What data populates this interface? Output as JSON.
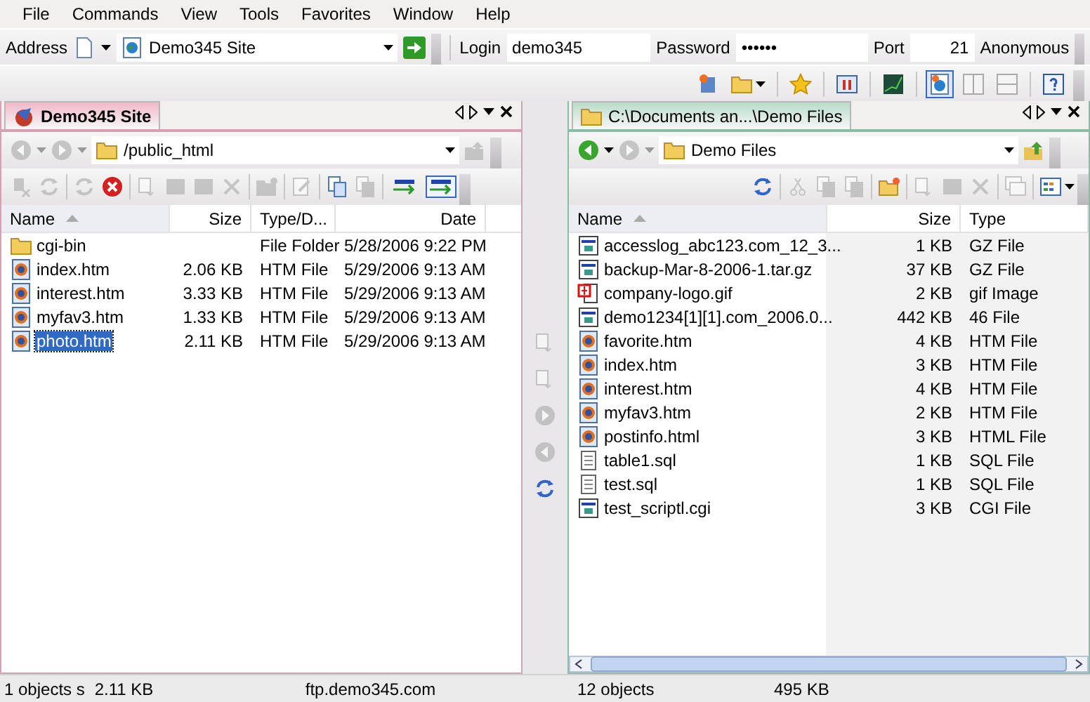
{
  "menu": [
    {
      "label": "File"
    },
    {
      "label": "Commands"
    },
    {
      "label": "View"
    },
    {
      "label": "Tools"
    },
    {
      "label": "Favorites"
    },
    {
      "label": "Window"
    },
    {
      "label": "Help"
    }
  ],
  "address_bar": {
    "label": "Address",
    "site": "Demo345 Site",
    "login_label": "Login",
    "login": "demo345",
    "password_label": "Password",
    "password": "••••••",
    "port_label": "Port",
    "port": "21",
    "anonymous_label": "Anonymous"
  },
  "toolbar": [
    {
      "kind": "site-manager"
    },
    {
      "kind": "open-folder"
    },
    {
      "kind": "separator"
    },
    {
      "kind": "favorite"
    },
    {
      "kind": "separator"
    },
    {
      "kind": "queue"
    },
    {
      "kind": "separator"
    },
    {
      "kind": "graph"
    },
    {
      "kind": "separator"
    },
    {
      "kind": "layout-single",
      "selected": true
    },
    {
      "kind": "layout-split",
      "selected": false
    },
    {
      "kind": "layout-stacked",
      "selected": false
    },
    {
      "kind": "separator"
    },
    {
      "kind": "help"
    }
  ],
  "panes": [
    {
      "tab": "Demo345 Site",
      "path": "/public_html",
      "up_disabled": true,
      "back_disabled": true,
      "forward_disabled": true,
      "tools": [
        {
          "kind": "disconnect",
          "disabled": true
        },
        {
          "kind": "reconnect",
          "disabled": true
        },
        {
          "kind": "separator"
        },
        {
          "kind": "refresh",
          "disabled": true
        },
        {
          "kind": "stop",
          "disabled": false
        },
        {
          "kind": "separator"
        },
        {
          "kind": "download",
          "disabled": true
        },
        {
          "kind": "console",
          "disabled": true
        },
        {
          "kind": "properties",
          "disabled": true
        },
        {
          "kind": "delete",
          "disabled": true
        },
        {
          "kind": "separator"
        },
        {
          "kind": "new-folder",
          "disabled": true
        },
        {
          "kind": "separator"
        },
        {
          "kind": "rename",
          "disabled": true
        },
        {
          "kind": "separator"
        },
        {
          "kind": "copy",
          "disabled": false
        },
        {
          "kind": "paste",
          "disabled": true
        },
        {
          "kind": "separator"
        },
        {
          "kind": "ascii",
          "disabled": false
        },
        {
          "kind": "binary",
          "disabled": false
        }
      ],
      "columns": [
        {
          "label": "Name",
          "sorted": true
        },
        {
          "label": "Size",
          "sorted": false
        },
        {
          "label": "Type/D...",
          "sorted": false
        },
        {
          "label": "Date",
          "sorted": false
        }
      ],
      "rows": [
        {
          "kind": "folder",
          "name": "cgi-bin",
          "type": "File Folder",
          "date": "5/28/2006 9:22 PM",
          "selected": false
        },
        {
          "kind": "web",
          "name": "index.htm",
          "size": "2.06 KB",
          "type": "HTM File",
          "date": "5/29/2006 9:13 AM",
          "selected": false
        },
        {
          "kind": "web",
          "name": "interest.htm",
          "size": "3.33 KB",
          "type": "HTM File",
          "date": "5/29/2006 9:13 AM",
          "selected": false
        },
        {
          "kind": "web",
          "name": "myfav3.htm",
          "size": "1.33 KB",
          "type": "HTM File",
          "date": "5/29/2006 9:13 AM",
          "selected": false
        },
        {
          "kind": "web",
          "name": "photo.htm",
          "size": "2.11 KB",
          "type": "HTM File",
          "date": "5/29/2006 9:13 AM",
          "selected": true
        }
      ],
      "status": [
        "1 objects s",
        "2.11 KB",
        "ftp.demo345.com"
      ]
    },
    {
      "tab": "C:\\Documents an...\\Demo Files",
      "path": "Demo Files",
      "up_disabled": false,
      "back_disabled": false,
      "forward_disabled": true,
      "tools": [
        {
          "kind": "refresh",
          "disabled": false
        },
        {
          "kind": "separator"
        },
        {
          "kind": "cut",
          "disabled": true
        },
        {
          "kind": "copy",
          "disabled": true
        },
        {
          "kind": "paste",
          "disabled": true
        },
        {
          "kind": "separator"
        },
        {
          "kind": "new-folder",
          "disabled": false
        },
        {
          "kind": "separator"
        },
        {
          "kind": "download",
          "disabled": true
        },
        {
          "kind": "properties",
          "disabled": true
        },
        {
          "kind": "delete",
          "disabled": true
        },
        {
          "kind": "separator"
        },
        {
          "kind": "cascade",
          "disabled": true
        },
        {
          "kind": "separator"
        },
        {
          "kind": "view",
          "disabled": false
        }
      ],
      "columns": [
        {
          "label": "Name",
          "sorted": true
        },
        {
          "label": "Size",
          "sorted": false
        },
        {
          "label": "Type",
          "sorted": false
        }
      ],
      "rows": [
        {
          "kind": "app",
          "name": "accesslog_abc123.com_12_3...",
          "size": "1 KB",
          "type": "GZ File",
          "selected": false
        },
        {
          "kind": "app",
          "name": "backup-Mar-8-2006-1.tar.gz",
          "size": "37 KB",
          "type": "GZ File",
          "selected": false
        },
        {
          "kind": "image",
          "name": "company-logo.gif",
          "size": "2 KB",
          "type": "gif Image",
          "selected": false
        },
        {
          "kind": "app",
          "name": "demo1234[1][1].com_2006.0...",
          "size": "442 KB",
          "type": "46 File",
          "selected": false
        },
        {
          "kind": "web",
          "name": "favorite.htm",
          "size": "4 KB",
          "type": "HTM File",
          "selected": false
        },
        {
          "kind": "web",
          "name": "index.htm",
          "size": "3 KB",
          "type": "HTM File",
          "selected": false
        },
        {
          "kind": "web",
          "name": "interest.htm",
          "size": "4 KB",
          "type": "HTM File",
          "selected": false
        },
        {
          "kind": "web",
          "name": "myfav3.htm",
          "size": "2 KB",
          "type": "HTM File",
          "selected": false
        },
        {
          "kind": "web",
          "name": "postinfo.html",
          "size": "3 KB",
          "type": "HTML File",
          "selected": false
        },
        {
          "kind": "text",
          "name": "table1.sql",
          "size": "1 KB",
          "type": "SQL File",
          "selected": false
        },
        {
          "kind": "text",
          "name": "test.sql",
          "size": "1 KB",
          "type": "SQL File",
          "selected": false
        },
        {
          "kind": "app",
          "name": "test_scriptl.cgi",
          "size": "3 KB",
          "type": "CGI File",
          "selected": false
        }
      ],
      "status": [
        "12 objects",
        "495 KB"
      ]
    }
  ],
  "transfer_buttons": [
    {
      "kind": "upload",
      "disabled": true
    },
    {
      "kind": "upload-queue",
      "disabled": true
    },
    {
      "kind": "forward",
      "disabled": true
    },
    {
      "kind": "back",
      "disabled": true
    },
    {
      "kind": "sync",
      "disabled": false
    }
  ]
}
